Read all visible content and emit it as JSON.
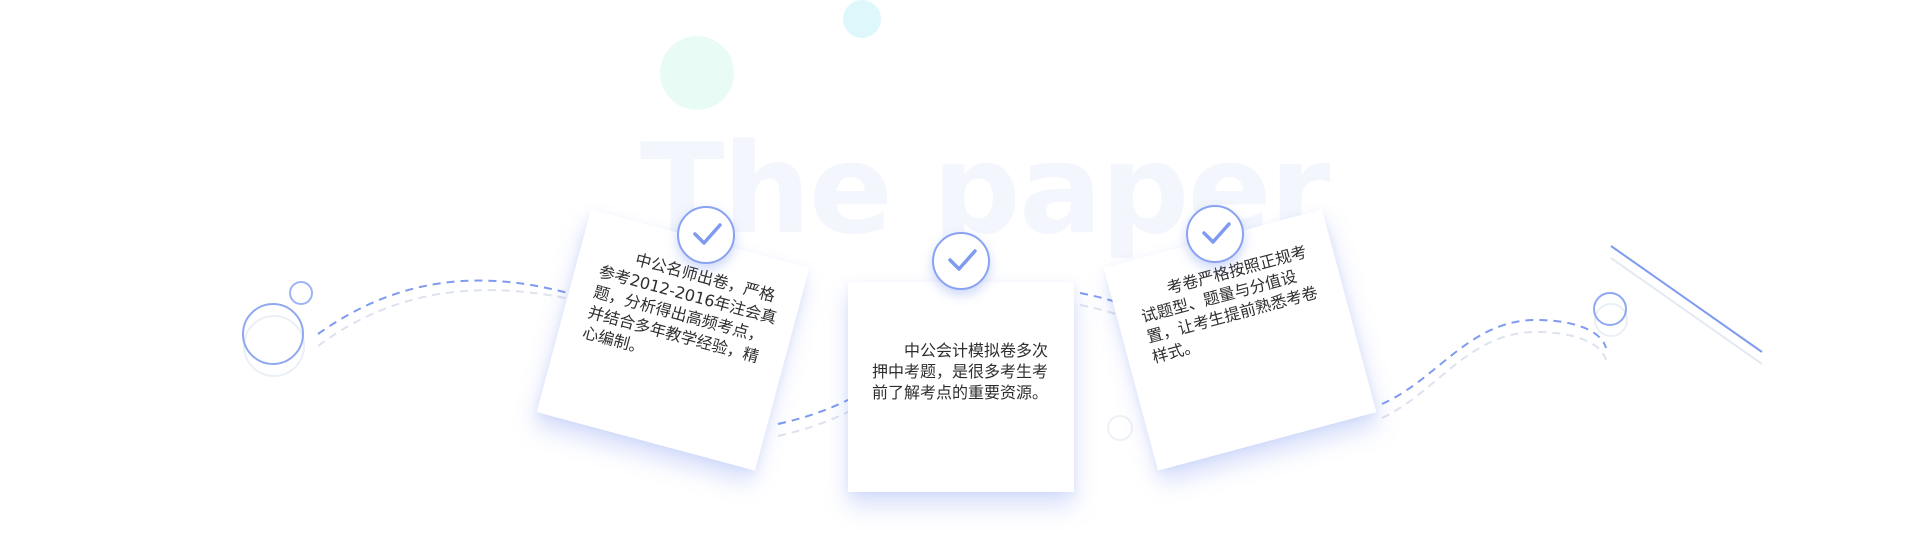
{
  "watermark": "The paper",
  "cards": [
    {
      "text": "中公名师出卷，严格参考2012-2016年注会真题，分析得出高频考点，并结合多年教学经验，精心编制。"
    },
    {
      "text": "中公会计模拟卷多次押中考题，是很多考生考前了解考点的重要资源。"
    },
    {
      "text": "考卷严格按照正规考试题型、题量与分值设置，让考生提前熟悉考卷样式。"
    }
  ],
  "icons": {
    "card_badge": "checkmark-icon"
  },
  "colors": {
    "accent": "#7f9bf0",
    "dash_light": "#dde3ee",
    "watermark": "#f3f6fc",
    "text": "#2e2e2e"
  }
}
